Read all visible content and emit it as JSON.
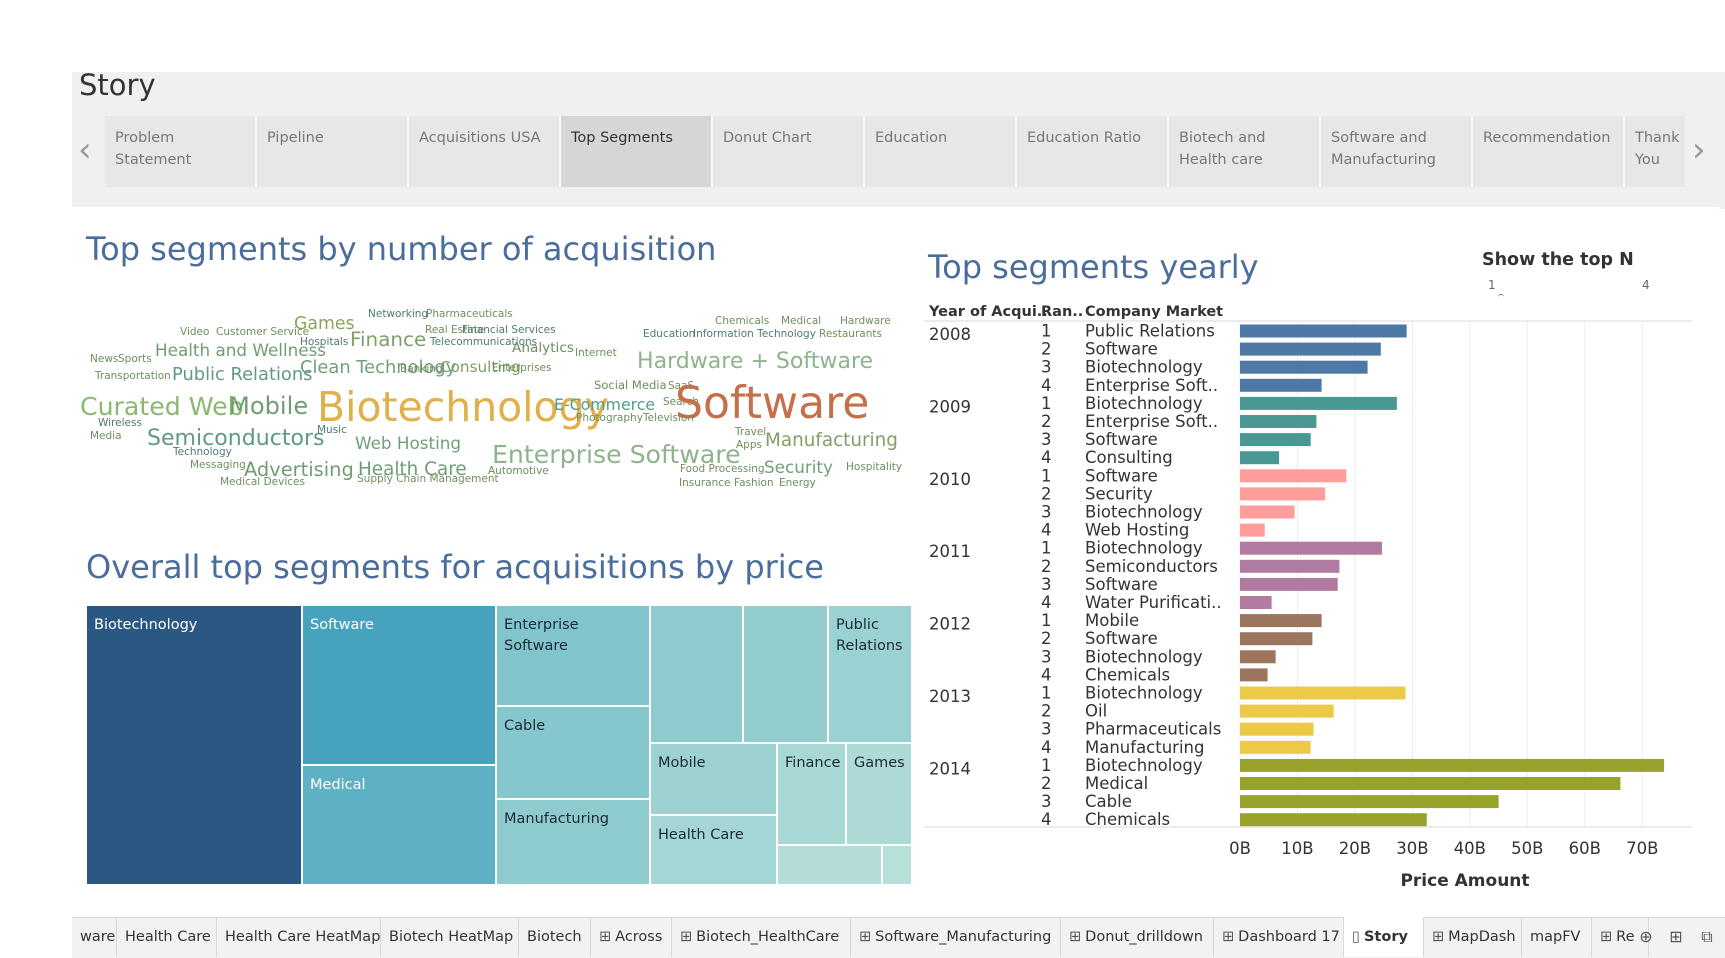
{
  "story": {
    "title": "Story",
    "prev_icon": "chevron-left-icon",
    "next_icon": "chevron-right-icon",
    "tabs": [
      {
        "label": "Problem\nStatement",
        "active": false
      },
      {
        "label": "Pipeline",
        "active": false
      },
      {
        "label": "Acquisitions USA",
        "active": false
      },
      {
        "label": "Top Segments",
        "active": true
      },
      {
        "label": "Donut Chart",
        "active": false
      },
      {
        "label": "Education",
        "active": false
      },
      {
        "label": "Education Ratio",
        "active": false
      },
      {
        "label": "Biotech and\nHealth care",
        "active": false
      },
      {
        "label": "Software and\nManufacturing",
        "active": false
      },
      {
        "label": "Recommendation",
        "active": false
      },
      {
        "label": "Thank You",
        "active": false
      }
    ]
  },
  "wordcloud": {
    "title": "Top segments by number of acquisition",
    "words": [
      {
        "text": "Networking"
      },
      {
        "text": "Pharmaceuticals"
      },
      {
        "text": "Games"
      },
      {
        "text": "Video"
      },
      {
        "text": "Customer Service"
      },
      {
        "text": "Finance"
      },
      {
        "text": "Real Estate"
      },
      {
        "text": "Financial Services"
      },
      {
        "text": "Hospitals"
      },
      {
        "text": "Telecommunications"
      },
      {
        "text": "Health and Wellness"
      },
      {
        "text": "News"
      },
      {
        "text": "Sports"
      },
      {
        "text": "Transportation"
      },
      {
        "text": "Clean Technology"
      },
      {
        "text": "Banking"
      },
      {
        "text": "Consulting"
      },
      {
        "text": "Enterprises"
      },
      {
        "text": "Public Relations"
      },
      {
        "text": "Analytics"
      },
      {
        "text": "Internet"
      },
      {
        "text": "Chemicals"
      },
      {
        "text": "Medical"
      },
      {
        "text": "Hardware"
      },
      {
        "text": "Education"
      },
      {
        "text": "Information Technology"
      },
      {
        "text": "Restaurants"
      },
      {
        "text": "Hardware + Software"
      },
      {
        "text": "Curated Web"
      },
      {
        "text": "Mobile"
      },
      {
        "text": "Biotechnology"
      },
      {
        "text": "Social Media"
      },
      {
        "text": "SaaS"
      },
      {
        "text": "E-Commerce"
      },
      {
        "text": "Search"
      },
      {
        "text": "Software"
      },
      {
        "text": "Photography"
      },
      {
        "text": "Television"
      },
      {
        "text": "Wireless"
      },
      {
        "text": "Media"
      },
      {
        "text": "Semiconductors"
      },
      {
        "text": "Music"
      },
      {
        "text": "Web Hosting"
      },
      {
        "text": "Enterprise Software"
      },
      {
        "text": "Travel"
      },
      {
        "text": "Apps"
      },
      {
        "text": "Manufacturing"
      },
      {
        "text": "Technology"
      },
      {
        "text": "Messaging"
      },
      {
        "text": "Advertising"
      },
      {
        "text": "Health Care"
      },
      {
        "text": "Automotive"
      },
      {
        "text": "Food Processing"
      },
      {
        "text": "Security"
      },
      {
        "text": "Hospitality"
      },
      {
        "text": "Medical Devices"
      },
      {
        "text": "Supply Chain Management"
      },
      {
        "text": "Insurance"
      },
      {
        "text": "Fashion"
      },
      {
        "text": "Energy"
      }
    ]
  },
  "treemap": {
    "title": "Overall top segments for acquisitions by price",
    "cells": [
      {
        "label": "Biotechnology"
      },
      {
        "label": "Software"
      },
      {
        "label": "Medical"
      },
      {
        "label": "Enterprise\nSoftware"
      },
      {
        "label": "Cable"
      },
      {
        "label": "Manufacturing"
      },
      {
        "label": ""
      },
      {
        "label": ""
      },
      {
        "label": "Public\nRelations"
      },
      {
        "label": "Mobile"
      },
      {
        "label": "Health Care"
      },
      {
        "label": "Finance"
      },
      {
        "label": "Games"
      },
      {
        "label": ""
      },
      {
        "label": ""
      },
      {
        "label": ""
      }
    ]
  },
  "yearly": {
    "title": "Top segments yearly",
    "filter": {
      "title": "Show the top N",
      "min": "1",
      "max": "4"
    },
    "headers": {
      "year": "Year of Acqui..",
      "rank": "Ran..",
      "market": "Company Market"
    }
  },
  "chart_data": {
    "type": "bar",
    "orientation": "horizontal",
    "xlabel": "Price Amount",
    "xlim": [
      0,
      75
    ],
    "x_unit": "B",
    "x_ticks": [
      "0B",
      "10B",
      "20B",
      "30B",
      "40B",
      "50B",
      "60B",
      "70B"
    ],
    "groups": [
      {
        "year": "2008",
        "color": "#4e79a7",
        "rows": [
          {
            "rank": "1",
            "market": "Public Relations",
            "value": 29
          },
          {
            "rank": "2",
            "market": "Software",
            "value": 24.5
          },
          {
            "rank": "3",
            "market": "Biotechnology",
            "value": 22.2
          },
          {
            "rank": "4",
            "market": "Enterprise Soft..",
            "value": 14.2
          }
        ]
      },
      {
        "year": "2009",
        "color": "#499894",
        "rows": [
          {
            "rank": "1",
            "market": "Biotechnology",
            "value": 27.3
          },
          {
            "rank": "2",
            "market": "Enterprise Soft..",
            "value": 13.3
          },
          {
            "rank": "3",
            "market": "Software",
            "value": 12.3
          },
          {
            "rank": "4",
            "market": "Consulting",
            "value": 6.8
          }
        ]
      },
      {
        "year": "2010",
        "color": "#ff9d9a",
        "rows": [
          {
            "rank": "1",
            "market": "Software",
            "value": 18.5
          },
          {
            "rank": "2",
            "market": "Security",
            "value": 14.8
          },
          {
            "rank": "3",
            "market": "Biotechnology",
            "value": 9.5
          },
          {
            "rank": "4",
            "market": "Web Hosting",
            "value": 4.3
          }
        ]
      },
      {
        "year": "2011",
        "color": "#b07aa1",
        "rows": [
          {
            "rank": "1",
            "market": "Biotechnology",
            "value": 24.7
          },
          {
            "rank": "2",
            "market": "Semiconductors",
            "value": 17.3
          },
          {
            "rank": "3",
            "market": "Software",
            "value": 17
          },
          {
            "rank": "4",
            "market": "Water Purificati..",
            "value": 5.5
          }
        ]
      },
      {
        "year": "2012",
        "color": "#9c755f",
        "rows": [
          {
            "rank": "1",
            "market": "Mobile",
            "value": 14.2
          },
          {
            "rank": "2",
            "market": "Software",
            "value": 12.6
          },
          {
            "rank": "3",
            "market": "Biotechnology",
            "value": 6.2
          },
          {
            "rank": "4",
            "market": "Chemicals",
            "value": 4.8
          }
        ]
      },
      {
        "year": "2013",
        "color": "#edc948",
        "rows": [
          {
            "rank": "1",
            "market": "Biotechnology",
            "value": 28.8
          },
          {
            "rank": "2",
            "market": "Oil",
            "value": 16.3
          },
          {
            "rank": "3",
            "market": "Pharmaceuticals",
            "value": 12.8
          },
          {
            "rank": "4",
            "market": "Manufacturing",
            "value": 12.3
          }
        ]
      },
      {
        "year": "2014",
        "color": "#98a32c",
        "rows": [
          {
            "rank": "1",
            "market": "Biotechnology",
            "value": 73.8
          },
          {
            "rank": "2",
            "market": "Medical",
            "value": 66.2
          },
          {
            "rank": "3",
            "market": "Cable",
            "value": 45
          },
          {
            "rank": "4",
            "market": "Chemicals",
            "value": 32.5
          }
        ]
      }
    ]
  },
  "bottom_tabs": [
    {
      "label": "ware",
      "icon": "",
      "active": false
    },
    {
      "label": "Health Care",
      "icon": "",
      "active": false
    },
    {
      "label": "Health Care HeatMap",
      "icon": "",
      "active": false
    },
    {
      "label": "Biotech HeatMap",
      "icon": "",
      "active": false
    },
    {
      "label": "Biotech",
      "icon": "",
      "active": false
    },
    {
      "label": "Across",
      "icon": "⊞",
      "active": false
    },
    {
      "label": "Biotech_HealthCare",
      "icon": "⊞",
      "active": false
    },
    {
      "label": "Software_Manufacturing",
      "icon": "⊞",
      "active": false
    },
    {
      "label": "Donut_drilldown",
      "icon": "⊞",
      "active": false
    },
    {
      "label": "Dashboard 17",
      "icon": "⊞",
      "active": false
    },
    {
      "label": "Story",
      "icon": "▯",
      "active": true
    },
    {
      "label": "MapDash",
      "icon": "⊞",
      "active": false
    },
    {
      "label": "mapFV",
      "icon": "",
      "active": false
    },
    {
      "label": "Re",
      "icon": "⊞",
      "active": false
    }
  ],
  "bottom_actions": [
    {
      "icon": "new-worksheet-icon",
      "glyph": "⊕"
    },
    {
      "icon": "new-dashboard-icon",
      "glyph": "⊞"
    },
    {
      "icon": "new-story-icon",
      "glyph": "⧉"
    }
  ]
}
